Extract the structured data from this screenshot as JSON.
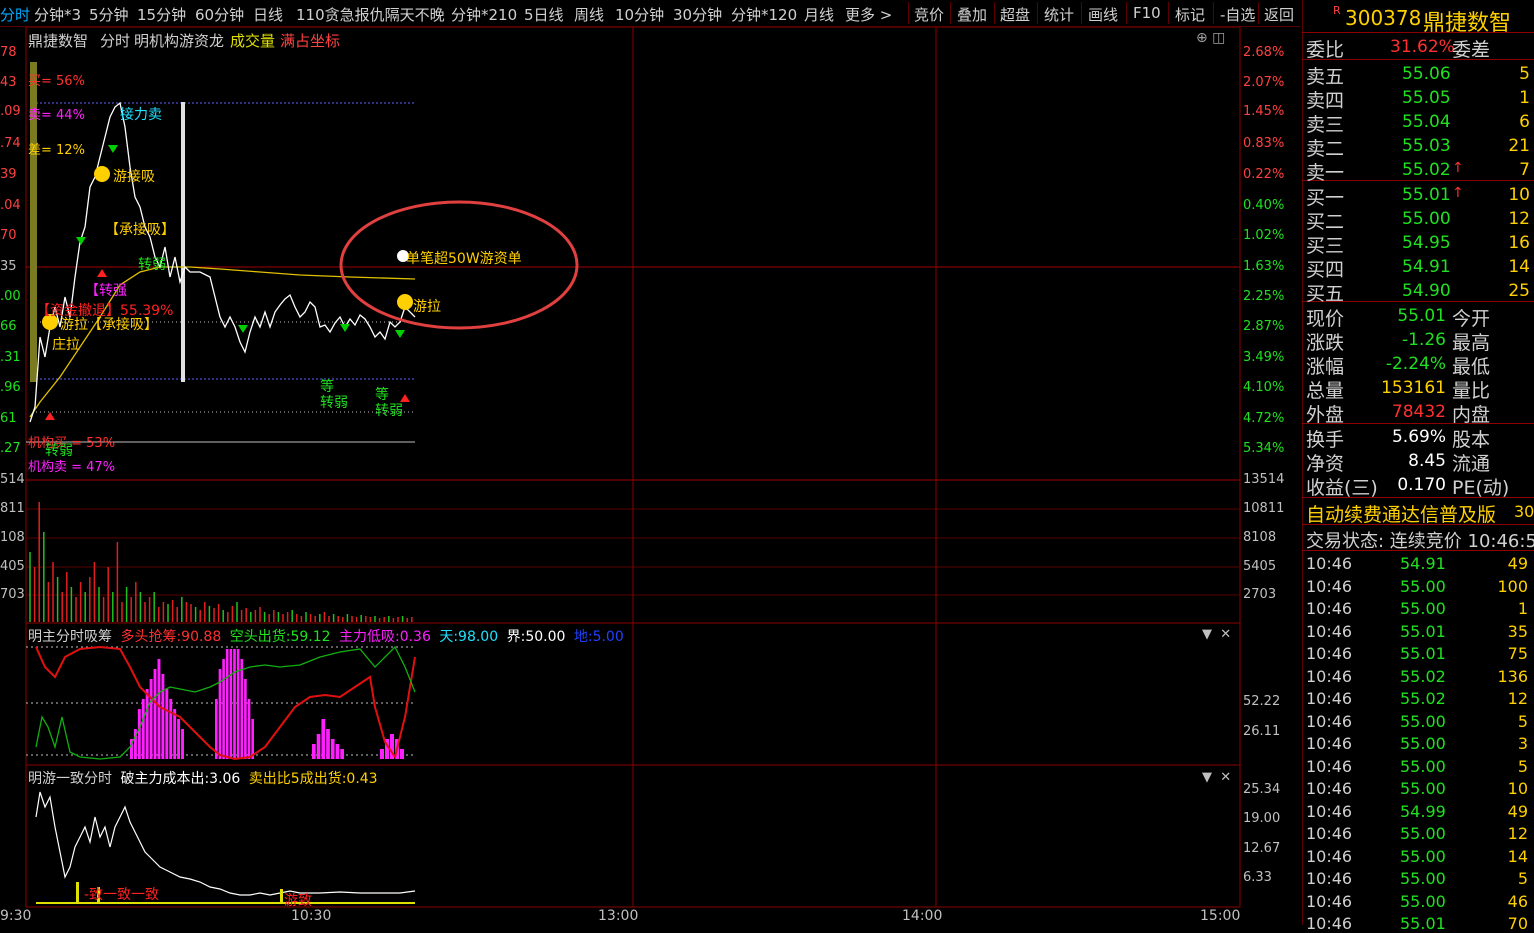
{
  "toolbar": {
    "items": [
      "分时",
      "分钟*3",
      "5分钟",
      "15分钟",
      "60分钟",
      "日线",
      "110贪急报仇隔天不晚",
      "分钟*210",
      "5日线",
      "周线",
      "10分钟",
      "30分钟",
      "分钟*120",
      "月线",
      "更多 >",
      "竞价",
      "叠加",
      "超盘",
      "统计",
      "画线",
      "F10",
      "标记",
      "-自选",
      "返回"
    ]
  },
  "chart": {
    "title_name": "鼎捷数智",
    "title_mode": "分时",
    "title_indicator": "明机构游资龙",
    "title_volume": "成交量",
    "title_fullscale": "满占坐标",
    "left_price_labels": [
      "78",
      "43",
      ".09",
      ".74",
      "39",
      ".04",
      "70",
      "35",
      ".00",
      "66",
      ".31",
      ".96",
      "61",
      ".27"
    ],
    "right_pct_labels": [
      "2.68%",
      "2.07%",
      "1.45%",
      "0.83%",
      "0.22%",
      "0.40%",
      "1.02%",
      "1.63%",
      "2.25%",
      "2.87%",
      "3.49%",
      "4.10%",
      "4.72%",
      "5.34%"
    ],
    "volume_left_labels": [
      "514",
      "811",
      "108",
      "405",
      "703"
    ],
    "volume_right_labels": [
      "13514",
      "10811",
      "8108",
      "5405",
      "2703"
    ],
    "annotations": {
      "buy_pct": "买= 56%",
      "sell_pct": "卖= 44%",
      "diff_pct": "差= 12%",
      "big_order": "单笔超50W游资单",
      "youla": "游拉",
      "jieli_sell": "接力卖",
      "hot_buy": "游接吸",
      "cheng_jie": "【承接吸】",
      "zhuan_qiang": "【转强",
      "fund_pct": "【资金撤退】55.39%",
      "you_cheng": "游拉【承接吸】",
      "zhuang_la": "庄拉",
      "inst_buy": "机构买 = 53%",
      "inst_sell": "机构卖 = 47%",
      "zhuan_ruo": "转弱",
      "deng": "等"
    }
  },
  "indicator1": {
    "name": "明主分时吸筹",
    "long_label": "多头抢筹:",
    "long_value": "90.88",
    "short_label": "空头出货:",
    "short_value": "59.12",
    "main_label": "主力低吸:",
    "main_value": "0.36",
    "sky_label": "天:",
    "sky_value": "98.00",
    "bound_label": "界:",
    "bound_value": "50.00",
    "earth_label": "地:",
    "earth_value": "5.00",
    "right_labels": [
      "52.22",
      "26.11"
    ]
  },
  "indicator2": {
    "name": "明游一致分时",
    "cost_label": "破主力成本出:",
    "cost_value": "3.06",
    "ratio_label": "卖出比5成出货:",
    "ratio_value": "0.43",
    "right_labels": [
      "25.34",
      "19.00",
      "12.67",
      "6.33"
    ],
    "marks": [
      "-致一致一致",
      "游致"
    ]
  },
  "time_axis": [
    "9:30",
    "10:30",
    "13:00",
    "14:00",
    "15:00"
  ],
  "quote": {
    "code": "300378",
    "name": "鼎捷数智",
    "r_mark": "R",
    "ratio_label": "委比",
    "ratio_value": "31.62%",
    "diff_label": "委差",
    "asks": [
      {
        "label": "卖五",
        "price": "55.06",
        "vol": "5",
        "arrow": ""
      },
      {
        "label": "卖四",
        "price": "55.05",
        "vol": "1",
        "arrow": ""
      },
      {
        "label": "卖三",
        "price": "55.04",
        "vol": "6",
        "arrow": ""
      },
      {
        "label": "卖二",
        "price": "55.03",
        "vol": "21",
        "arrow": ""
      },
      {
        "label": "卖一",
        "price": "55.02",
        "vol": "7",
        "arrow": "↑"
      }
    ],
    "bids": [
      {
        "label": "买一",
        "price": "55.01",
        "vol": "10",
        "arrow": "↑"
      },
      {
        "label": "买二",
        "price": "55.00",
        "vol": "12",
        "arrow": ""
      },
      {
        "label": "买三",
        "price": "54.95",
        "vol": "16",
        "arrow": ""
      },
      {
        "label": "买四",
        "price": "54.91",
        "vol": "14",
        "arrow": ""
      },
      {
        "label": "买五",
        "price": "54.90",
        "vol": "25",
        "arrow": ""
      }
    ],
    "stats": [
      {
        "l": "现价",
        "v": "55.01",
        "r": "今开"
      },
      {
        "l": "涨跌",
        "v": "-1.26",
        "r": "最高"
      },
      {
        "l": "涨幅",
        "v": "-2.24%",
        "r": "最低"
      },
      {
        "l": "总量",
        "v": "153161",
        "r": "量比"
      },
      {
        "l": "外盘",
        "v": "78432",
        "r": "内盘"
      }
    ],
    "stats2": [
      {
        "l": "换手",
        "v": "5.69%",
        "r": "股本"
      },
      {
        "l": "净资",
        "v": "8.45",
        "r": "流通"
      },
      {
        "l": "收益(三)",
        "v": "0.170",
        "r": "PE(动)"
      }
    ],
    "banner": "自动续费通达信普及版",
    "banner_num": "30",
    "status": "交易状态: 连续竞价 10:46:5",
    "ticks": [
      {
        "t": "10:46",
        "p": "54.91",
        "v": "49"
      },
      {
        "t": "10:46",
        "p": "55.00",
        "v": "100"
      },
      {
        "t": "10:46",
        "p": "55.00",
        "v": "1"
      },
      {
        "t": "10:46",
        "p": "55.01",
        "v": "35"
      },
      {
        "t": "10:46",
        "p": "55.01",
        "v": "75"
      },
      {
        "t": "10:46",
        "p": "55.02",
        "v": "136"
      },
      {
        "t": "10:46",
        "p": "55.02",
        "v": "12"
      },
      {
        "t": "10:46",
        "p": "55.00",
        "v": "5"
      },
      {
        "t": "10:46",
        "p": "55.00",
        "v": "3"
      },
      {
        "t": "10:46",
        "p": "55.00",
        "v": "5"
      },
      {
        "t": "10:46",
        "p": "55.00",
        "v": "10"
      },
      {
        "t": "10:46",
        "p": "54.99",
        "v": "49"
      },
      {
        "t": "10:46",
        "p": "55.00",
        "v": "12"
      },
      {
        "t": "10:46",
        "p": "55.00",
        "v": "14"
      },
      {
        "t": "10:46",
        "p": "55.00",
        "v": "5"
      },
      {
        "t": "10:46",
        "p": "55.00",
        "v": "46"
      },
      {
        "t": "10:46",
        "p": "55.01",
        "v": "70"
      }
    ]
  }
}
